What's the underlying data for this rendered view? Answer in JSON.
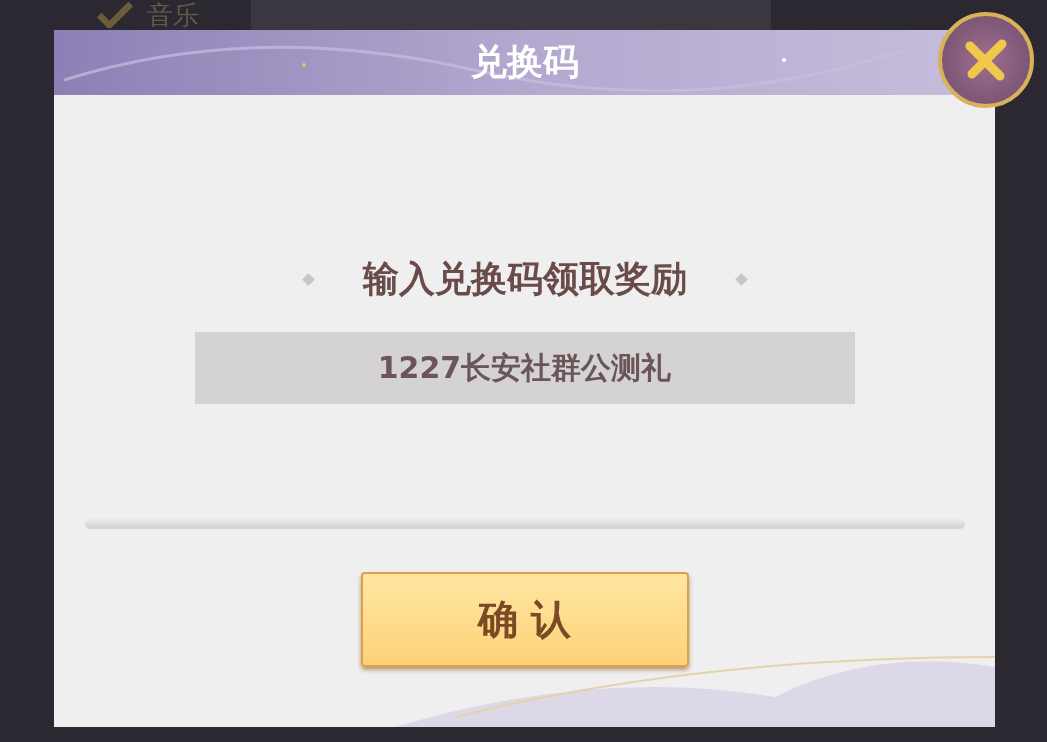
{
  "background": {
    "setting_label": "音乐",
    "setting_checked": true
  },
  "dialog": {
    "title": "兑换码",
    "prompt": "输入兑换码领取奖励",
    "code_field": {
      "value": "1227长安社群公测礼"
    },
    "confirm_button": "确 认"
  }
}
